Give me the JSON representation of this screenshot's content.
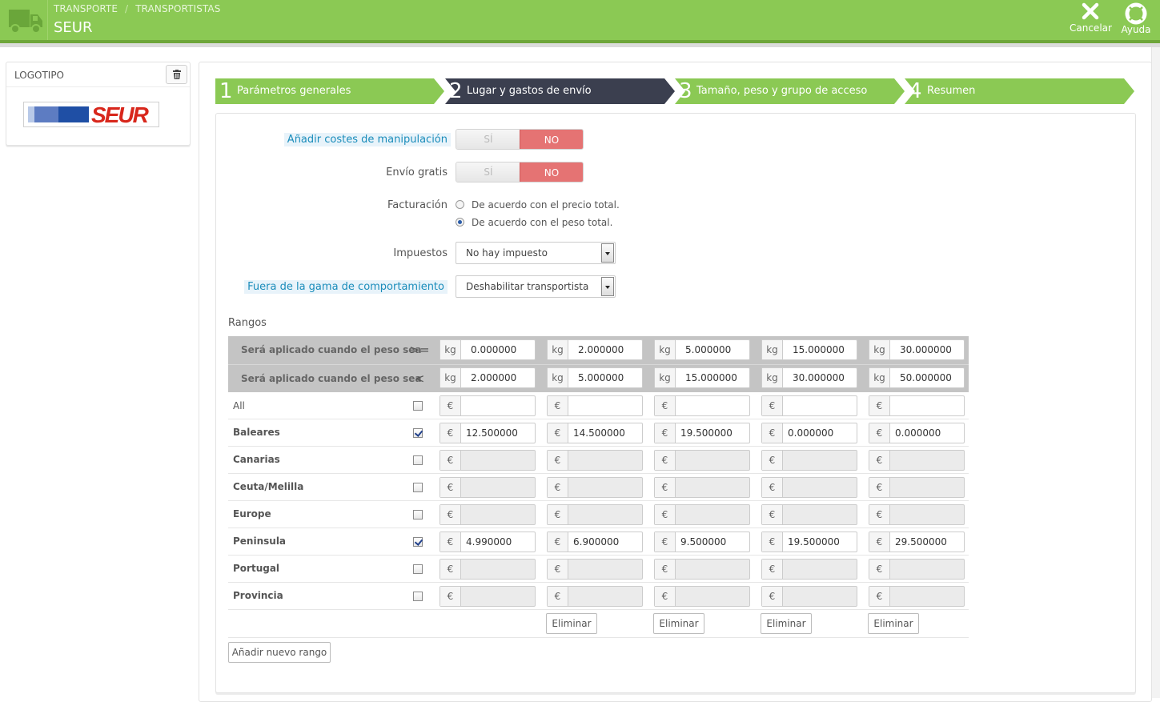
{
  "header": {
    "breadcrumb": [
      "TRANSPORTE",
      "TRANSPORTISTAS"
    ],
    "breadcrumb_sep": "/",
    "title": "SEUR",
    "cancel_label": "Cancelar",
    "help_label": "Ayuda",
    "icon": "truck-icon"
  },
  "logo_panel": {
    "title": "LOGOTIPO",
    "logo_text": "SEUR"
  },
  "steps": [
    {
      "num": "1",
      "label": "Parámetros generales",
      "active": false
    },
    {
      "num": "2",
      "label": "Lugar y gastos de envío",
      "active": true
    },
    {
      "num": "3",
      "label": "Tamaño, peso y grupo de acceso",
      "active": false
    },
    {
      "num": "4",
      "label": "Resumen",
      "active": false
    }
  ],
  "form": {
    "handling_label": "Añadir costes de manipulación",
    "free_label": "Envío gratis",
    "toggle_yes": "SÍ",
    "toggle_no": "NO",
    "billing_label": "Facturación",
    "billing_options": [
      "De acuerdo con el precio total.",
      "De acuerdo con el peso total."
    ],
    "billing_selected": 1,
    "tax_label": "Impuestos",
    "tax_value": "No hay impuesto",
    "out_of_range_label": "Fuera de la gama de comportamiento",
    "out_of_range_value": "Deshabilitar transportista"
  },
  "ranges": {
    "title": "Rangos",
    "row_label": "Será aplicado cuando el peso sea",
    "op_from": ">=",
    "op_to": "<",
    "unit": "kg",
    "currency": "€",
    "from": [
      "0.000000",
      "2.000000",
      "5.000000",
      "15.000000",
      "30.000000"
    ],
    "to": [
      "2.000000",
      "5.000000",
      "15.000000",
      "30.000000",
      "50.000000"
    ],
    "zones": [
      {
        "name": "All",
        "checked": false,
        "enabled": true,
        "bold": false,
        "prices": [
          "",
          "",
          "",
          "",
          ""
        ]
      },
      {
        "name": "Baleares",
        "checked": true,
        "enabled": true,
        "bold": true,
        "prices": [
          "12.500000",
          "14.500000",
          "19.500000",
          "0.000000",
          "0.000000"
        ]
      },
      {
        "name": "Canarias",
        "checked": false,
        "enabled": false,
        "bold": true,
        "prices": [
          "",
          "",
          "",
          "",
          ""
        ]
      },
      {
        "name": "Ceuta/Melilla",
        "checked": false,
        "enabled": false,
        "bold": true,
        "prices": [
          "",
          "",
          "",
          "",
          ""
        ]
      },
      {
        "name": "Europe",
        "checked": false,
        "enabled": false,
        "bold": true,
        "prices": [
          "",
          "",
          "",
          "",
          ""
        ]
      },
      {
        "name": "Peninsula",
        "checked": true,
        "enabled": true,
        "bold": true,
        "prices": [
          "4.990000",
          "6.900000",
          "9.500000",
          "19.500000",
          "29.500000"
        ]
      },
      {
        "name": "Portugal",
        "checked": false,
        "enabled": false,
        "bold": true,
        "prices": [
          "",
          "",
          "",
          "",
          ""
        ]
      },
      {
        "name": "Provincia",
        "checked": false,
        "enabled": false,
        "bold": true,
        "prices": [
          "",
          "",
          "",
          "",
          ""
        ]
      }
    ],
    "delete_label": "Eliminar",
    "add_range_label": "Añadir nuevo rango"
  },
  "colors": {
    "header_green": "#8bc954",
    "step_green": "#8bc954",
    "step_active": "#3b3f4f",
    "toggle_no": "#e57373"
  }
}
